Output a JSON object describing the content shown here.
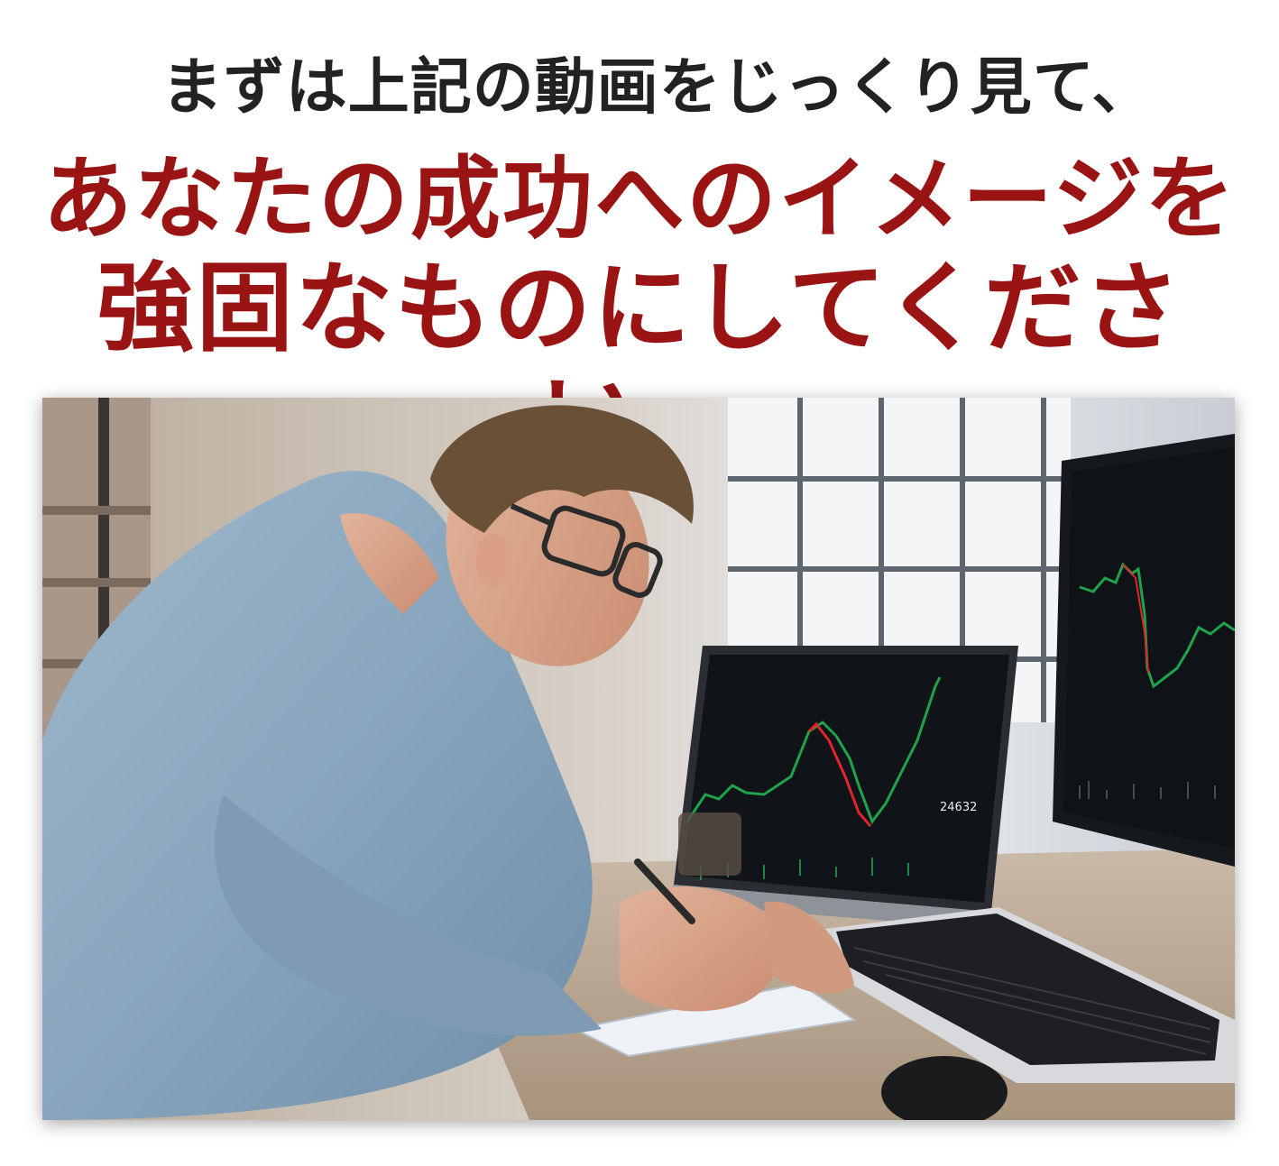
{
  "headline": {
    "line1": "まずは上記の動画をじっくり見て、",
    "line2": "あなたの成功へのイメージを",
    "line3": "強固なものにしてください。"
  },
  "photo": {
    "subject": "trader-at-desk",
    "screen_price": "24632",
    "colors": {
      "up": "#1fa34a",
      "down": "#e0252b",
      "screen": "#101419"
    }
  }
}
